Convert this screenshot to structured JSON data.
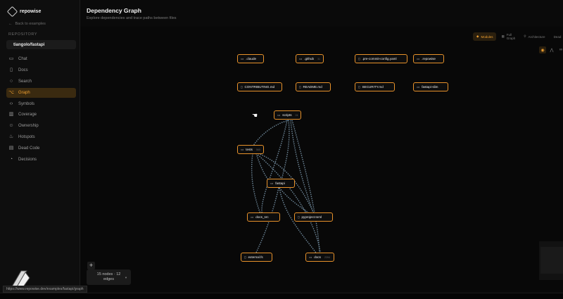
{
  "app": {
    "name": "repowise"
  },
  "sidebar": {
    "back_label": "Back to examples",
    "section_label": "REPOSITORY",
    "repo_name": "tiangolo/fastapi",
    "items": [
      {
        "label": "Chat",
        "icon": "chat-icon"
      },
      {
        "label": "Docs",
        "icon": "book-icon"
      },
      {
        "label": "Search",
        "icon": "search-icon"
      },
      {
        "label": "Graph",
        "icon": "graph-icon",
        "active": true
      },
      {
        "label": "Symbols",
        "icon": "code-icon"
      },
      {
        "label": "Coverage",
        "icon": "bar-chart-icon"
      },
      {
        "label": "Ownership",
        "icon": "users-icon"
      },
      {
        "label": "Hotspots",
        "icon": "flame-icon"
      },
      {
        "label": "Dead Code",
        "icon": "file-x-icon"
      },
      {
        "label": "Decisions",
        "icon": "lightbulb-icon"
      }
    ]
  },
  "header": {
    "title": "Dependency Graph",
    "subtitle": "Explore dependencies and trace paths between files"
  },
  "toolbar": {
    "modules": "Modules",
    "full_graph": "Full Graph",
    "architecture": "Architecture",
    "overflow": "Dead"
  },
  "nodes": {
    "claude": {
      "label": ".claude",
      "count": ""
    },
    "github": {
      "label": ".github",
      "count": "31"
    },
    "precommit": {
      "label": ".pre-commit-config.yaml",
      "count": ""
    },
    "repowise": {
      "label": ".repowise",
      "count": ""
    },
    "contributing": {
      "label": "CONTRIBUTING.md",
      "count": ""
    },
    "readme": {
      "label": "README.md",
      "count": ""
    },
    "security": {
      "label": "SECURITY.md",
      "count": ""
    },
    "slim": {
      "label": "fastapi-slim",
      "count": ""
    },
    "scripts": {
      "label": "scripts",
      "count": "24"
    },
    "tests": {
      "label": "tests",
      "count": "565"
    },
    "fastapi": {
      "label": "fastapi",
      "count": ""
    },
    "docs_src": {
      "label": "docs_src",
      "count": ""
    },
    "pyproject": {
      "label": "pyproject.toml",
      "count": ""
    },
    "external": {
      "label": "external.fs",
      "count": ""
    },
    "docs": {
      "label": "docs",
      "count": "2394"
    }
  },
  "stats": {
    "line1": "15 nodes · 12",
    "line2": "edges"
  },
  "status_url": "https://www.repowise.dev/examples/fastapi/graph",
  "colors": {
    "accent": "#e8922a",
    "edge": "#8fb0c8",
    "background": "#0a0a0a"
  }
}
